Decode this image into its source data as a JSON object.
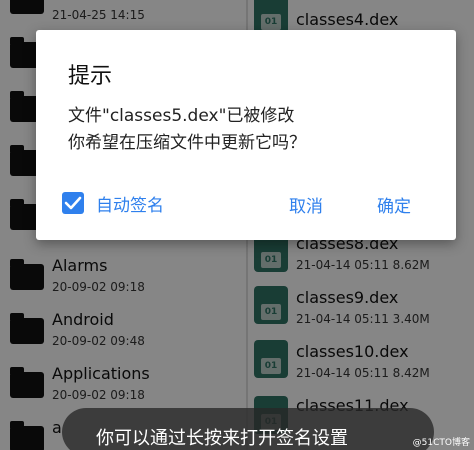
{
  "left_pane": {
    "items": [
      {
        "name": "",
        "date": "21-04-25 14:15"
      },
      {
        "name": "",
        "date": ""
      },
      {
        "name": "",
        "date": ""
      },
      {
        "name": "",
        "date": ""
      },
      {
        "name": "Alarms",
        "date": "20-09-02 09:18"
      },
      {
        "name": "Android",
        "date": "20-09-02 09:48"
      },
      {
        "name": "Applications",
        "date": "20-09-02 09:18"
      },
      {
        "name": "a",
        "date": ""
      }
    ]
  },
  "right_pane": {
    "items": [
      {
        "name": "classes4.dex",
        "meta": ""
      },
      {
        "name": "classes8.dex",
        "meta": "21-04-14 05:11  8.62M"
      },
      {
        "name": "classes9.dex",
        "meta": "21-04-14 05:11  3.40M"
      },
      {
        "name": "classes10.dex",
        "meta": "21-04-14 05:11  8.42M"
      },
      {
        "name": "classes11.dex",
        "meta": ""
      }
    ],
    "file_badge": "01"
  },
  "dialog": {
    "title": "提示",
    "message_line1": "文件\"classes5.dex\"已被修改",
    "message_line2": "你希望在压缩文件中更新它吗？",
    "checkbox_label": "自动签名",
    "checkbox_checked": true,
    "cancel_label": "取消",
    "ok_label": "确定",
    "accent_color": "#2f80ed"
  },
  "toast": {
    "text": "你可以通过长按来打开签名设置"
  },
  "watermark": "@51CTO博客"
}
